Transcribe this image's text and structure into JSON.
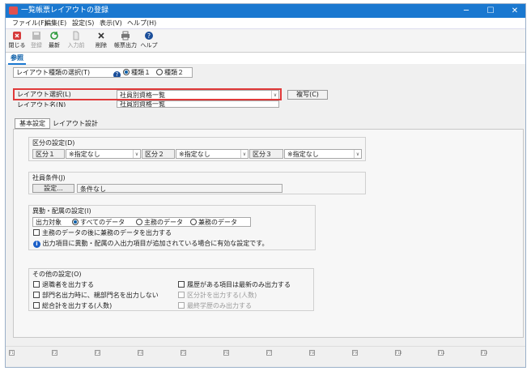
{
  "window": {
    "title": "一覧帳票レイアウトの登録",
    "minimize": "─",
    "maximize": "☐",
    "close": "✕"
  },
  "menu": [
    "ファイル(F)",
    "編集(E)",
    "設定(S)",
    "表示(V)",
    "ヘルプ(H)"
  ],
  "toolbar": {
    "close": "閉じる",
    "register": "登録",
    "refresh": "最新",
    "input_prev": "入力前",
    "delete": "削除",
    "report_output": "帳票出力",
    "help": "ヘルプ"
  },
  "tab": "参照",
  "layout_type": {
    "label": "レイアウト種類の選択(T)",
    "help": "?",
    "option1": "種類１",
    "option2": "種類２",
    "selected": "option1"
  },
  "layout_select": {
    "label": "レイアウト選択(L)",
    "value": "社員別資格一覧",
    "copy_button": "複写(C)"
  },
  "layout_name": {
    "label": "レイアウト名(N)",
    "value": "社員別資格一覧"
  },
  "subtabs": {
    "basic": "基本設定",
    "layout_design": "レイアウト設計"
  },
  "category": {
    "title": "区分の設定(D)",
    "c1_label": "区分１",
    "c1_value": "※指定なし",
    "c2_label": "区分２",
    "c2_value": "※指定なし",
    "c3_label": "区分３",
    "c3_value": "※指定なし"
  },
  "employee_cond": {
    "title": "社員条件(J)",
    "button": "設定...",
    "value": "条件なし"
  },
  "transfer": {
    "title": "異動・配属の設定(I)",
    "target_label": "出力対象",
    "opt_all": "すべてのデータ",
    "opt_main": "主務のデータ",
    "opt_concurrent": "兼務のデータ",
    "selected": "opt_all",
    "checkbox": "主務のデータの後に兼務のデータを出力する",
    "info_icon": "i",
    "info": "出力項目に異動・配属の入出力項目が追加されている場合に有効な設定です。"
  },
  "other": {
    "title": "その他の設定(O)",
    "c1": "退職者を出力する",
    "c2": "部門名出力時に、親部門名を出力しない",
    "c3": "総合計を出力する(人数)",
    "c4": "履歴がある項目は最新のみ出力する",
    "c5": "区分計を出力する(人数)",
    "c6": "最終学歴のみ出力する"
  },
  "fkeys": [
    "F1",
    "F2",
    "F3",
    "F4",
    "F5",
    "F6",
    "F7",
    "F8",
    "F9",
    "F10",
    "F11",
    "F12"
  ]
}
